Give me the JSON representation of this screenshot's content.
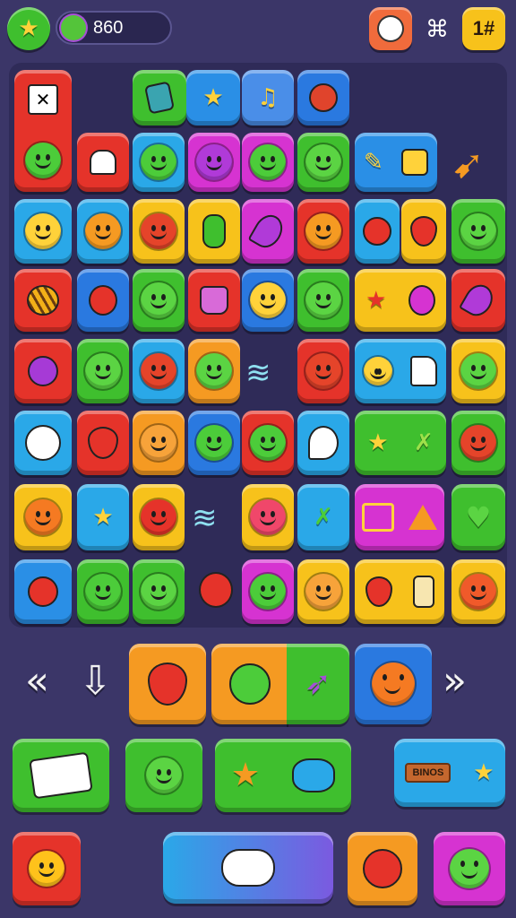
{
  "hud": {
    "score": "860",
    "level_label": "1#",
    "icons": {
      "level_star": "star-icon",
      "avatar": "frog-avatar-icon",
      "chef": "chef-hat-icon",
      "shuffle": "shuffle-icon"
    }
  },
  "board": {
    "label_note": "BINOS"
  },
  "colors": {
    "background": "#3b3668",
    "red": "#e5332a",
    "green": "#3fbf2e",
    "blue": "#2a8fe6",
    "yellow": "#f7c21b",
    "magenta": "#d633d1",
    "orange": "#f59a22"
  }
}
